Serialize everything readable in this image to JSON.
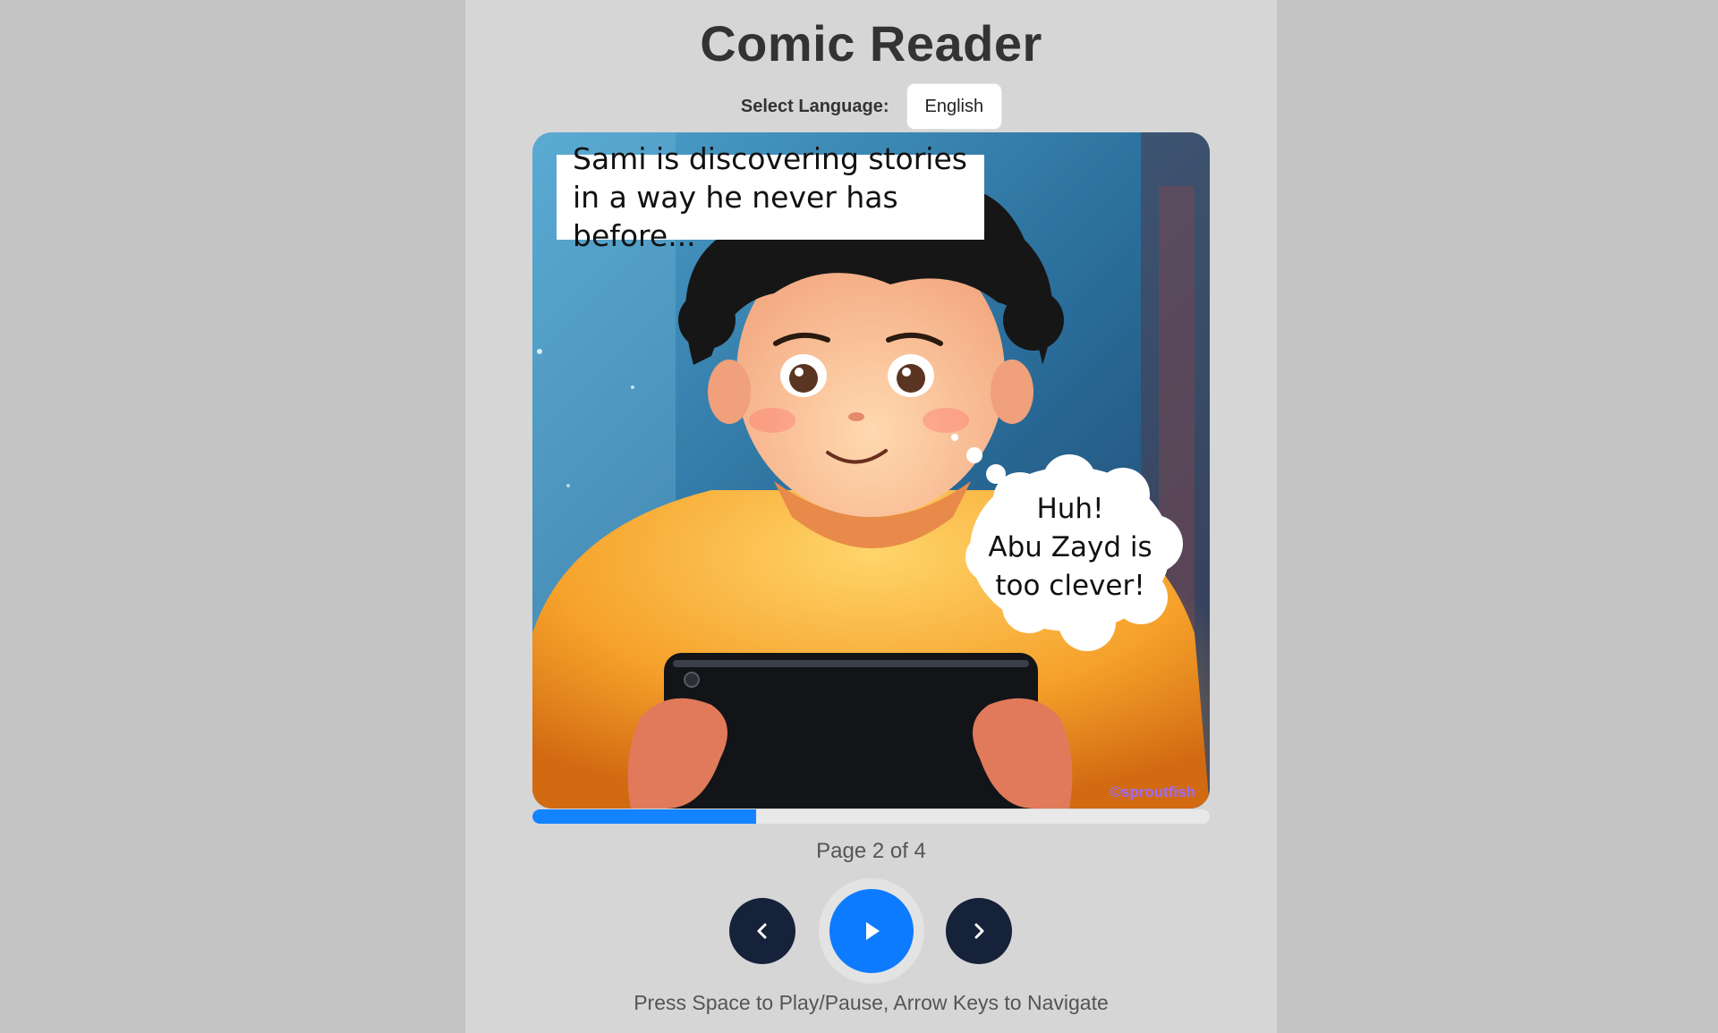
{
  "app": {
    "title": "Comic Reader"
  },
  "language": {
    "label": "Select Language:",
    "selected": "English"
  },
  "comic": {
    "caption": "Sami is discovering stories in a way he never has before...",
    "thought_lines": [
      "Huh!",
      "Abu Zayd is",
      "too clever!"
    ],
    "watermark": "©sproutfish"
  },
  "progress": {
    "current_page": 2,
    "total_pages": 4,
    "fill_fraction": 0.33,
    "label": "Page 2 of 4"
  },
  "controls": {
    "prev_icon": "chevron-left-icon",
    "play_icon": "play-icon",
    "next_icon": "chevron-right-icon"
  },
  "hint": "Press Space to Play/Pause, Arrow Keys to Navigate",
  "colors": {
    "accent": "#0d7bff",
    "nav_button": "#16213a",
    "progress_fill": "#1483ff"
  }
}
